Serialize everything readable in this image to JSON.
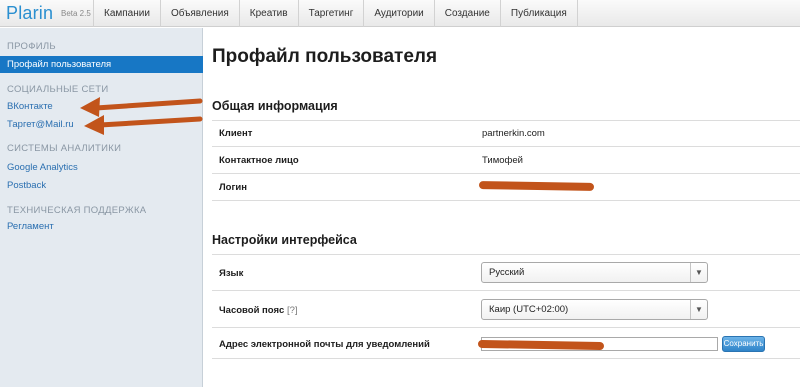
{
  "app": {
    "name": "Plarin",
    "version": "Beta 2.5"
  },
  "nav": [
    "Кампании",
    "Объявления",
    "Креатив",
    "Таргетинг",
    "Аудитории",
    "Создание",
    "Публикация"
  ],
  "sidebar": {
    "profile_header": "ПРОФИЛЬ",
    "profile_active": "Профайл пользователя",
    "social_header": "СОЦИАЛЬНЫЕ СЕТИ",
    "social_items": [
      "ВКонтакте",
      "Таргет@Mail.ru"
    ],
    "analytics_header": "СИСТЕМЫ АНАЛИТИКИ",
    "analytics_items": [
      "Google Analytics",
      "Postback"
    ],
    "support_header": "ТЕХНИЧЕСКАЯ ПОДДЕРЖКА",
    "support_items": [
      "Регламент"
    ]
  },
  "main": {
    "title": "Профайл пользователя",
    "general": {
      "title": "Общая информация",
      "client_label": "Клиент",
      "client_value": "partnerkin.com",
      "contact_label": "Контактное лицо",
      "contact_value": "Тимофей",
      "login_label": "Логин"
    },
    "interface": {
      "title": "Настройки интерфейса",
      "language_label": "Язык",
      "language_value": "Русский",
      "timezone_label": "Часовой пояс",
      "timezone_hint": "[?]",
      "timezone_value": "Каир (UTC+02:00)",
      "email_label": "Адрес электронной почты для уведомлений",
      "save_label": "Сохранить"
    }
  },
  "colors": {
    "accent": "#1777c5",
    "annotation": "#c2541b",
    "sidebar_bg": "#e4eaf0"
  },
  "icons": {
    "select_arrow": "chevron-down-icon",
    "annotation_arrows": "arrow-left-icon"
  }
}
